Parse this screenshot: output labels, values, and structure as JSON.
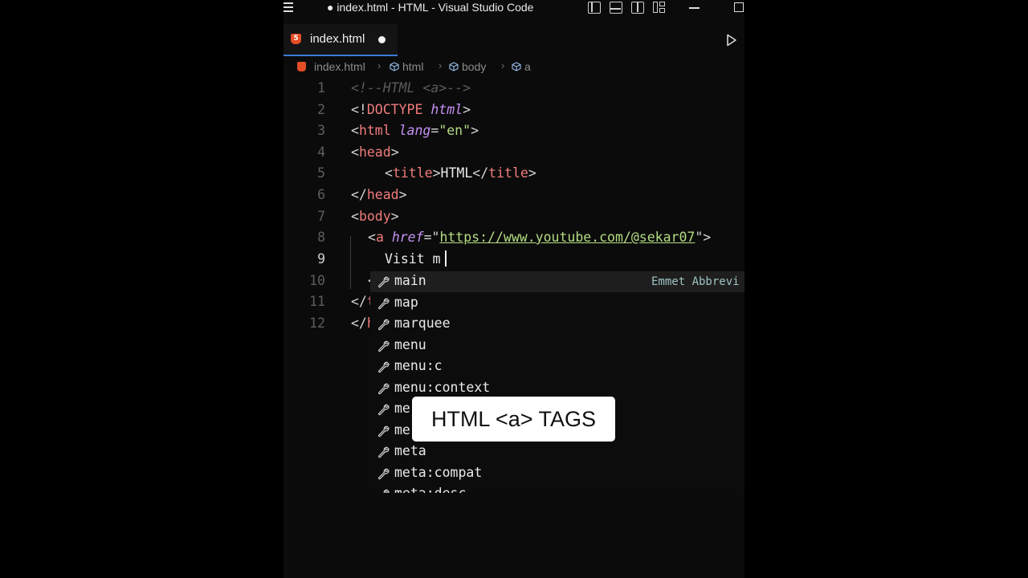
{
  "window": {
    "title": "● index.html - HTML - Visual Studio Code"
  },
  "tab": {
    "label": "index.html",
    "file_icon": "html5-icon",
    "dirty": true
  },
  "breadcrumb": [
    "index.html",
    "html",
    "body",
    "a"
  ],
  "editor": {
    "lines": [
      {
        "n": "1"
      },
      {
        "n": "2"
      },
      {
        "n": "3"
      },
      {
        "n": "4"
      },
      {
        "n": "5"
      },
      {
        "n": "6"
      },
      {
        "n": "7"
      },
      {
        "n": "8"
      },
      {
        "n": "9"
      },
      {
        "n": "10"
      },
      {
        "n": "11"
      },
      {
        "n": "12"
      }
    ],
    "code": {
      "l1": "<!--HTML <a>-->",
      "l2_open": "<!",
      "l2_tag": "DOCTYPE",
      "l2_attr": "html",
      "l3_tag": "html",
      "l3_attr": "lang",
      "l3_val": "\"en\"",
      "l4_tag": "head",
      "l5_tag": "title",
      "l5_text": "HTML",
      "l6_tag": "head",
      "l7_tag": "body",
      "l8_tag": "a",
      "l8_attr": "href",
      "l8_url": "https://www.youtube.com/@sekar07",
      "l9_text": "Visit m",
      "l10_partial": "<",
      "l11_partial": "</",
      "l11_tagpart": "t",
      "l12_partial": "</",
      "l12_tagpart": "h"
    }
  },
  "suggest": {
    "items": [
      "main",
      "map",
      "marquee",
      "menu",
      "menu:c",
      "menu:context",
      "me",
      "me",
      "meta",
      "meta:compat",
      "meta:desc"
    ],
    "detail": "Emmet Abbrevi",
    "item_icon": "wrench-icon"
  },
  "caption": "HTML <a> TAGS",
  "colors": {
    "tag": "#f07c7c",
    "attr": "#c591f3",
    "string": "#b5dd82",
    "comment": "#5b5b5b",
    "accent": "#3a7bd5"
  }
}
